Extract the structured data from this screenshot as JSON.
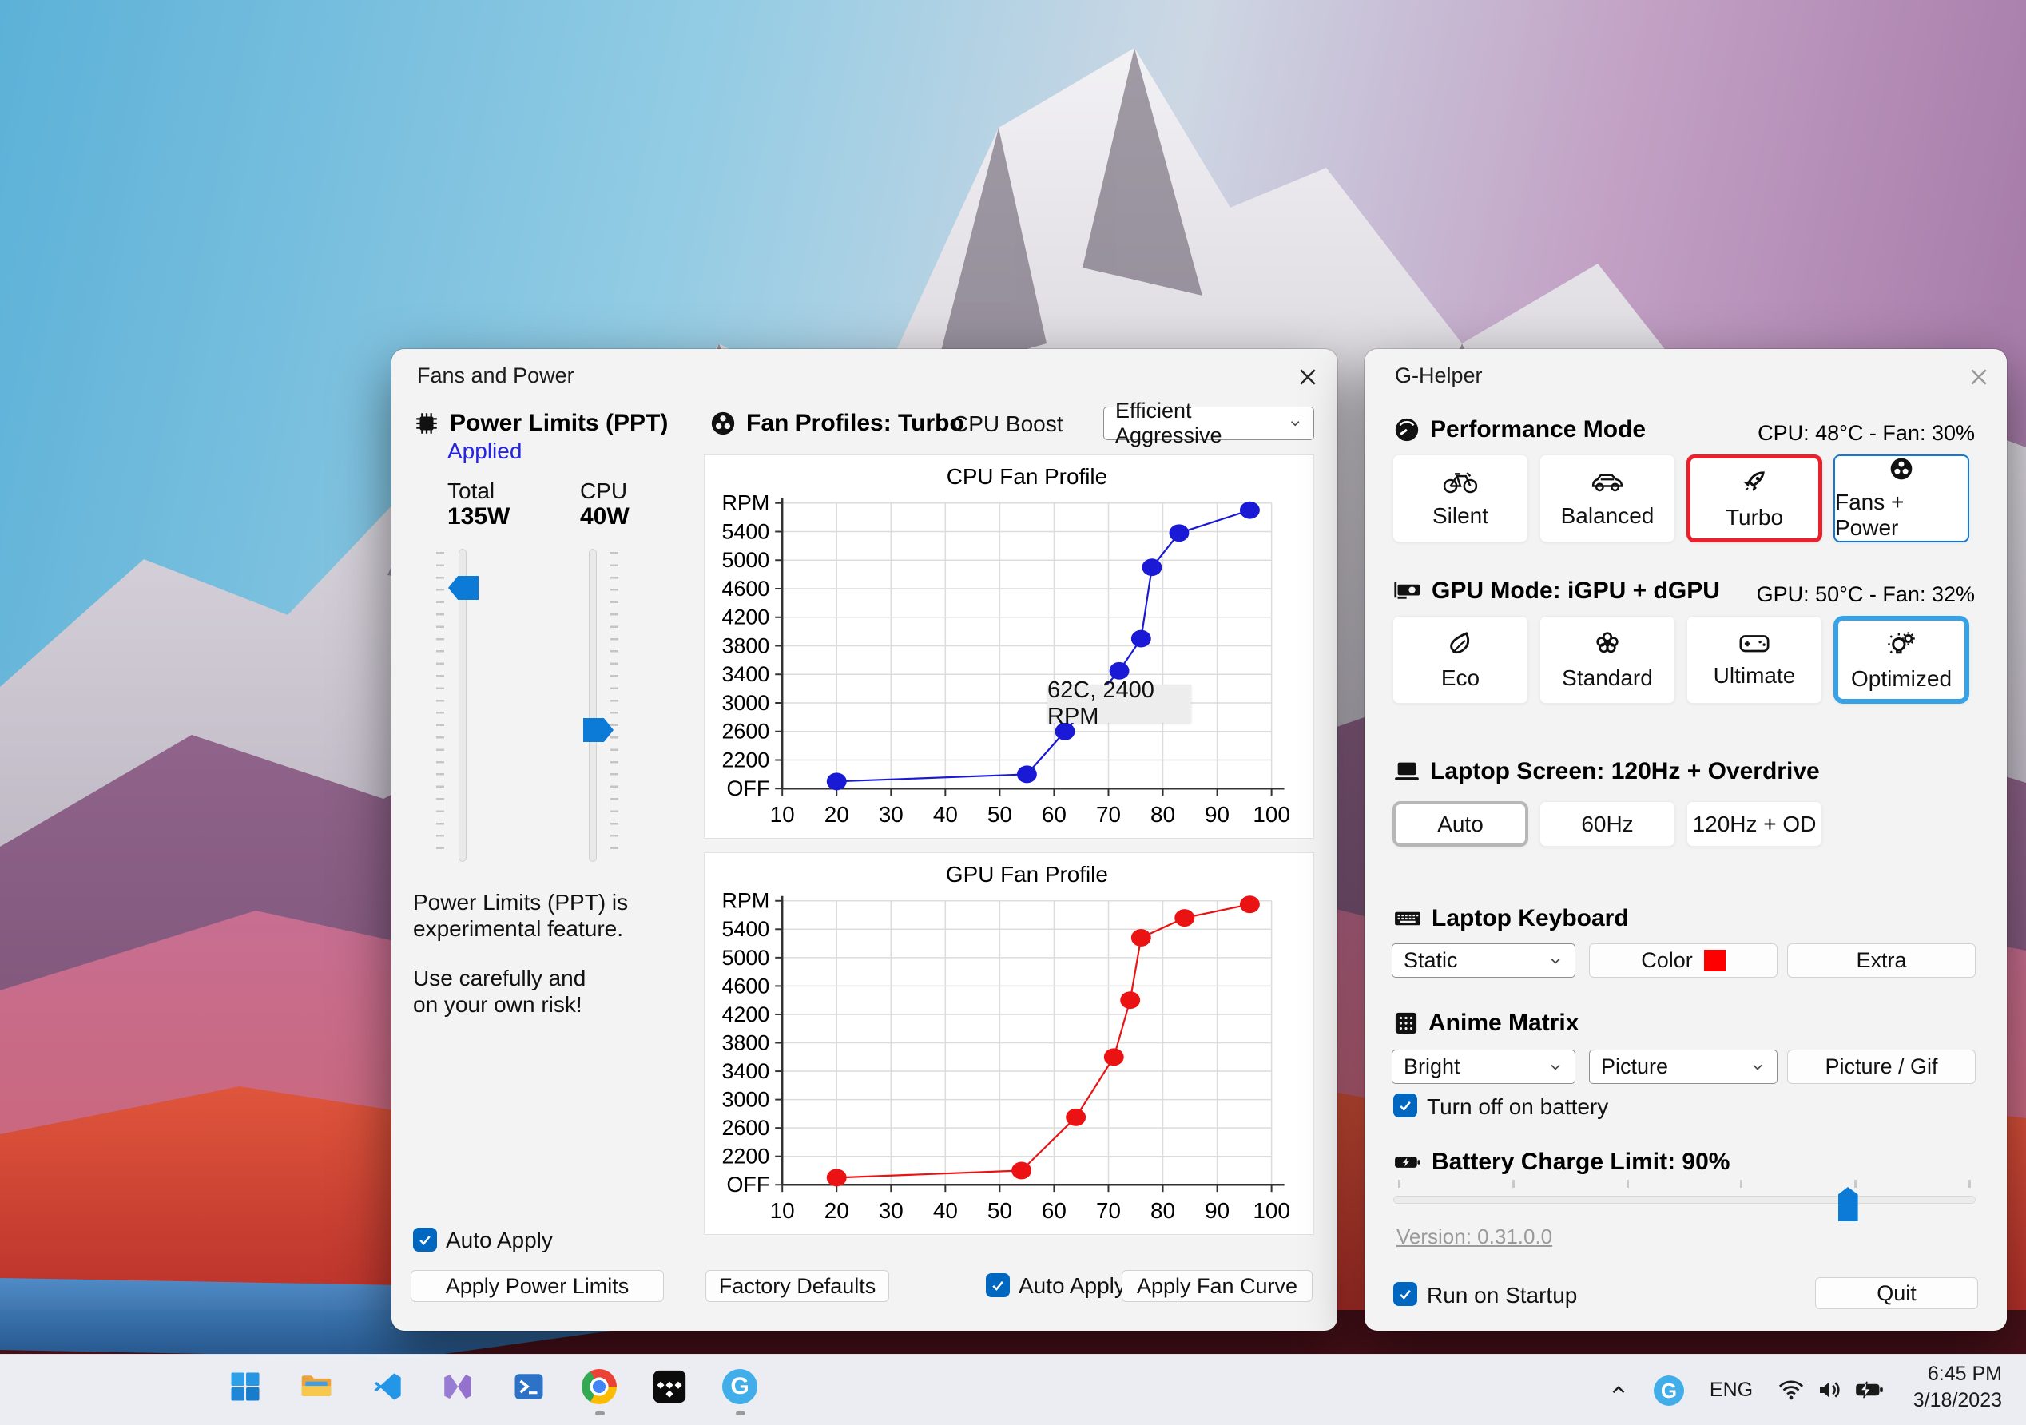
{
  "fans_window": {
    "title": "Fans and Power",
    "power_limits": {
      "heading": "Power Limits (PPT)",
      "status": "Applied",
      "total_label": "Total",
      "total_value": "135W",
      "cpu_label": "CPU",
      "cpu_value": "40W",
      "warning_line1": "Power Limits (PPT) is",
      "warning_line2": "experimental feature.",
      "warning_line3": "Use carefully and",
      "warning_line4": "on your own risk!",
      "auto_apply_label": "Auto Apply",
      "apply_button": "Apply Power Limits"
    },
    "fan_profiles": {
      "heading": "Fan Profiles: Turbo",
      "cpu_boost_label": "CPU Boost",
      "cpu_boost_value": "Efficient Aggressive",
      "tooltip": "62C, 2400 RPM",
      "factory_defaults_button": "Factory Defaults",
      "auto_apply_label": "Auto Apply",
      "apply_fan_curve_button": "Apply Fan Curve"
    }
  },
  "chart_data": [
    {
      "type": "line",
      "title": "CPU Fan Profile",
      "color": "#1a1ad6",
      "xlim": [
        10,
        100
      ],
      "ylim": [
        1800,
        5800
      ],
      "x_ticks": [
        10,
        20,
        30,
        40,
        50,
        60,
        70,
        80,
        90,
        100
      ],
      "y_ticks": [
        {
          "label": "OFF",
          "value": 1800
        },
        {
          "label": "2200",
          "value": 2200
        },
        {
          "label": "2600",
          "value": 2600
        },
        {
          "label": "3000",
          "value": 3000
        },
        {
          "label": "3400",
          "value": 3400
        },
        {
          "label": "3800",
          "value": 3800
        },
        {
          "label": "4200",
          "value": 4200
        },
        {
          "label": "4600",
          "value": 4600
        },
        {
          "label": "5000",
          "value": 5000
        },
        {
          "label": "5400",
          "value": 5400
        },
        {
          "label": "RPM",
          "value": 5800
        }
      ],
      "points": [
        [
          20,
          1900
        ],
        [
          55,
          2000
        ],
        [
          62,
          2600
        ],
        [
          72,
          3450
        ],
        [
          76,
          3900
        ],
        [
          78,
          4900
        ],
        [
          83,
          5380
        ],
        [
          96,
          5700
        ]
      ],
      "grid": true,
      "tooltip": "62C, 2400 RPM"
    },
    {
      "type": "line",
      "title": "GPU Fan Profile",
      "color": "#ea1212",
      "xlim": [
        10,
        100
      ],
      "ylim": [
        1800,
        5800
      ],
      "x_ticks": [
        10,
        20,
        30,
        40,
        50,
        60,
        70,
        80,
        90,
        100
      ],
      "y_ticks": [
        {
          "label": "OFF",
          "value": 1800
        },
        {
          "label": "2200",
          "value": 2200
        },
        {
          "label": "2600",
          "value": 2600
        },
        {
          "label": "3000",
          "value": 3000
        },
        {
          "label": "3400",
          "value": 3400
        },
        {
          "label": "3800",
          "value": 3800
        },
        {
          "label": "4200",
          "value": 4200
        },
        {
          "label": "4600",
          "value": 4600
        },
        {
          "label": "5000",
          "value": 5000
        },
        {
          "label": "5400",
          "value": 5400
        },
        {
          "label": "RPM",
          "value": 5800
        }
      ],
      "points": [
        [
          20,
          1900
        ],
        [
          54,
          2000
        ],
        [
          64,
          2750
        ],
        [
          71,
          3600
        ],
        [
          74,
          4400
        ],
        [
          76,
          5280
        ],
        [
          84,
          5560
        ],
        [
          96,
          5750
        ]
      ],
      "grid": true
    }
  ],
  "ghelper_window": {
    "title": "G-Helper",
    "performance": {
      "heading": "Performance Mode",
      "status": "CPU: 48°C -  Fan: 30%",
      "modes": [
        {
          "label": "Silent",
          "icon": "bicycle-icon"
        },
        {
          "label": "Balanced",
          "icon": "car-icon"
        },
        {
          "label": "Turbo",
          "icon": "rocket-icon"
        },
        {
          "label": "Fans + Power",
          "icon": "fan-icon"
        }
      ]
    },
    "gpu": {
      "heading": "GPU Mode: iGPU + dGPU",
      "status": "GPU: 50°C -  Fan: 32%",
      "modes": [
        {
          "label": "Eco",
          "icon": "leaf-icon"
        },
        {
          "label": "Standard",
          "icon": "flower-icon"
        },
        {
          "label": "Ultimate",
          "icon": "gamepad-icon"
        },
        {
          "label": "Optimized",
          "icon": "bulb-gear-icon"
        }
      ]
    },
    "screen": {
      "heading": "Laptop Screen: 120Hz + Overdrive",
      "options": [
        {
          "label": "Auto"
        },
        {
          "label": "60Hz"
        },
        {
          "label": "120Hz + OD"
        }
      ]
    },
    "keyboard": {
      "heading": "Laptop Keyboard",
      "mode_value": "Static",
      "color_button": "Color",
      "swatch_color": "#ff0000",
      "extra_button": "Extra"
    },
    "matrix": {
      "heading": "Anime Matrix",
      "brightness_value": "Bright",
      "mode_value": "Picture",
      "picture_button": "Picture / Gif",
      "battery_checkbox": "Turn off on battery"
    },
    "battery": {
      "heading": "Battery Charge Limit: 90%",
      "slider_percent": 78
    },
    "version_link": "Version: 0.31.0.0",
    "startup_checkbox": "Run on Startup",
    "quit_button": "Quit"
  },
  "taskbar": {
    "g_badge": "G",
    "tray": {
      "language": "ENG",
      "time": "6:45 PM",
      "date": "3/18/2023"
    }
  }
}
